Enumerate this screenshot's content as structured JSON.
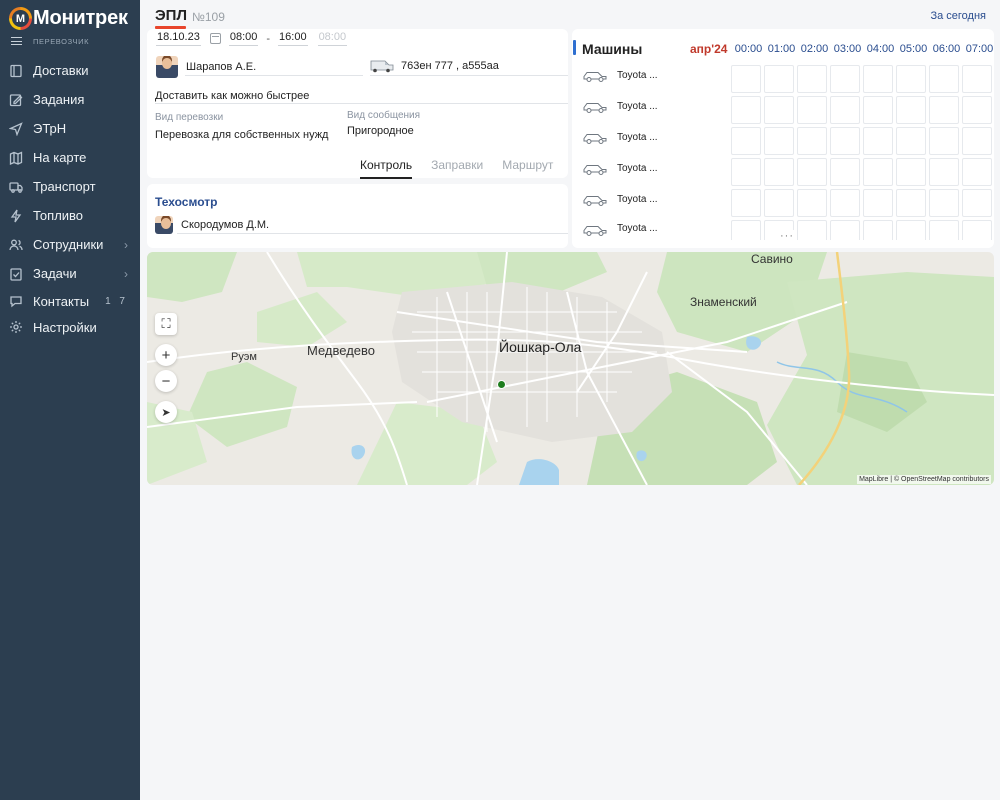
{
  "brand": {
    "name": "Монитрек",
    "logo_letter": "М",
    "role": "ПЕРЕВОЗЧИК"
  },
  "nav": [
    {
      "label": "Доставки",
      "icon": "book-icon"
    },
    {
      "label": "Задания",
      "icon": "edit-icon"
    },
    {
      "label": "ЭТрН",
      "icon": "send-icon"
    },
    {
      "label": "На карте",
      "icon": "map-icon"
    },
    {
      "label": "Транспорт",
      "icon": "truck-icon"
    },
    {
      "label": "Топливо",
      "icon": "bolt-icon"
    },
    {
      "label": "Сотрудники",
      "icon": "users-icon",
      "chevron": "›"
    },
    {
      "label": "Задачи",
      "icon": "tasks-icon",
      "chevron": "›"
    },
    {
      "label": "Контакты",
      "icon": "chat-icon",
      "badge": "1 7"
    },
    {
      "label": "Настройки",
      "icon": "gear-icon"
    }
  ],
  "header": {
    "title": "ЭПЛ",
    "number": "№109",
    "today_link": "За сегодня"
  },
  "trip": {
    "date": "18.10.23",
    "time_from": "08:00",
    "time_sep": "-",
    "time_to": "16:00",
    "time_extra": "08:00",
    "driver": "Шарапов А.Е.",
    "vehicle": "763ен 777 , а555аа",
    "note": "Доставить как можно быстрее",
    "transport_type_label": "Вид перевозки",
    "transport_type": "Перевозка для собственных нужд",
    "route_type_label": "Вид сообщения",
    "route_type": "Пригородное",
    "tabs": [
      "Контроль",
      "Заправки",
      "Маршрут"
    ]
  },
  "inspection": {
    "title": "Техосмотр",
    "person": "Скородумов Д.М."
  },
  "cars": {
    "title": "Машины",
    "month": "апр'24",
    "hours": [
      "00:00",
      "01:00",
      "02:00",
      "03:00",
      "04:00",
      "05:00",
      "06:00",
      "07:00"
    ],
    "items": [
      "Toyota ...",
      "Toyota ...",
      "Toyota ...",
      "Toyota ...",
      "Toyota ...",
      "Toyota ..."
    ],
    "more": "···"
  },
  "map": {
    "labels": {
      "city": "Йошкар-Ола",
      "town1": "Медведево",
      "town2": "Руэм",
      "town3": "Знаменский",
      "town4": "Савино"
    },
    "attribution": "MapLibre | © OpenStreetMap contributors",
    "controls": {
      "fullscreen": "⛶",
      "zoom_in": "+",
      "zoom_out": "−",
      "locate": "➤"
    }
  },
  "colors": {
    "sidebar": "#2c3e50",
    "accent": "#e8452c",
    "link": "#2a4d8f",
    "marker": "#1e7d1e"
  }
}
